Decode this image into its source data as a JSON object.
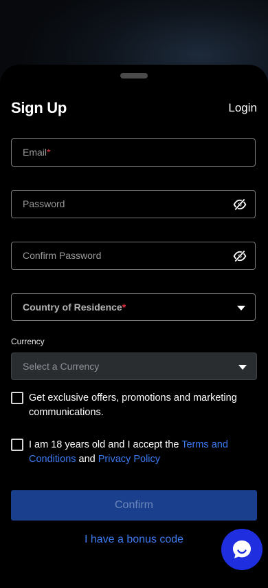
{
  "header": {
    "title": "Sign Up",
    "login_label": "Login"
  },
  "form": {
    "email_placeholder": "Email",
    "required_mark": "*",
    "password_placeholder": "Password",
    "confirm_password_placeholder": "Confirm Password",
    "country_placeholder": "Country of Residence",
    "currency_label": "Currency",
    "currency_placeholder": "Select a Currency",
    "offers_text": "Get exclusive offers, promotions and marketing communications.",
    "age_text_prefix": "I am 18 years old and I accept the ",
    "terms_link": "Terms and Conditions",
    "and_text": " and ",
    "privacy_link": "Privacy Policy",
    "confirm_label": "Confirm",
    "bonus_link": "I have a bonus code"
  },
  "icons": {
    "password_toggle": "eye-off-icon",
    "dropdown": "caret-down-icon",
    "chat": "chat-bubble-icon"
  },
  "colors": {
    "accent": "#3d7bf2",
    "button": "#1a3f8c",
    "required": "#e0323c",
    "chat_button": "#1f2fe0"
  }
}
